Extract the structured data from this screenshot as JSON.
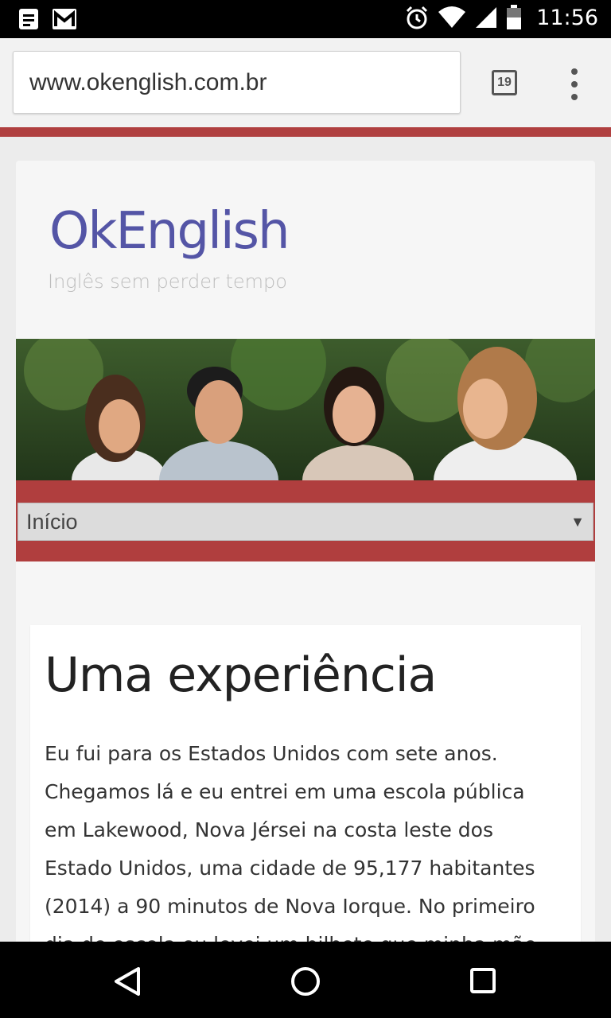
{
  "status_bar": {
    "time": "11:56",
    "icons": [
      "notes-icon",
      "gmail-icon",
      "alarm-icon",
      "wifi-icon",
      "signal-icon",
      "battery-icon"
    ]
  },
  "browser": {
    "url": "www.okenglish.com.br",
    "tab_count": "19",
    "menu_icon": "overflow-menu-icon"
  },
  "site": {
    "logo": "OkEnglish",
    "tagline": "Inglês sem perder tempo",
    "nav_select": {
      "selected": "Início"
    },
    "colors": {
      "brand": "#5455a6",
      "accent": "#b03e3e"
    }
  },
  "article": {
    "title": "Uma experiência",
    "body": "Eu fui para os Estados Unidos com sete anos. Chegamos lá e eu entrei em uma escola pública em Lakewood, Nova Jérsei na costa leste dos Estado Unidos, uma cidade de 95,177 habitantes (2014) a 90 minutos de Nova Iorque. No primeiro dia de escola eu levei um bilhete que minha mãe tinha"
  },
  "system_nav": {
    "icons": [
      "back-icon",
      "home-icon",
      "recents-icon"
    ]
  }
}
